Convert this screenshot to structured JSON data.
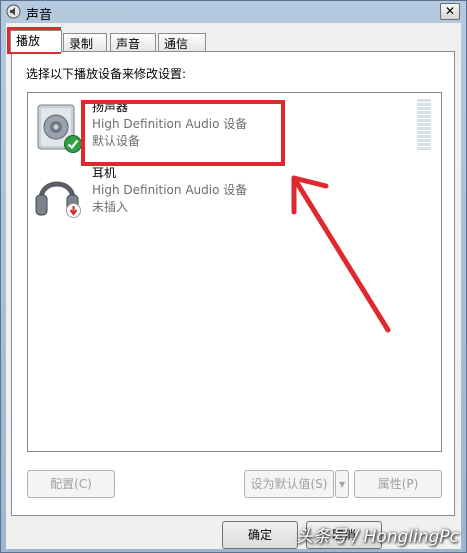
{
  "window": {
    "title": "声音"
  },
  "tabs": [
    {
      "label": "播放",
      "active": true
    },
    {
      "label": "录制",
      "active": false
    },
    {
      "label": "声音",
      "active": false
    },
    {
      "label": "通信",
      "active": false
    }
  ],
  "panel": {
    "instructions": "选择以下播放设备来修改设置:"
  },
  "devices": [
    {
      "name": "扬声器",
      "driver": "High Definition Audio 设备",
      "status": "默认设备",
      "icon": "speaker-icon",
      "badge": "default-check-icon"
    },
    {
      "name": "耳机",
      "driver": "High Definition Audio 设备",
      "status": "未插入",
      "icon": "headphones-icon",
      "badge": "unplugged-icon"
    }
  ],
  "buttons": {
    "configure": "配置(C)",
    "set_default": "设为默认值(S)",
    "properties": "属性(P)",
    "ok": "确定",
    "cancel": "取消"
  },
  "watermark": "头条号 / HonglingPc",
  "colors": {
    "annotation": "#e0282f",
    "title_bar": "#a9bfd6",
    "check_green": "#2ea043"
  }
}
